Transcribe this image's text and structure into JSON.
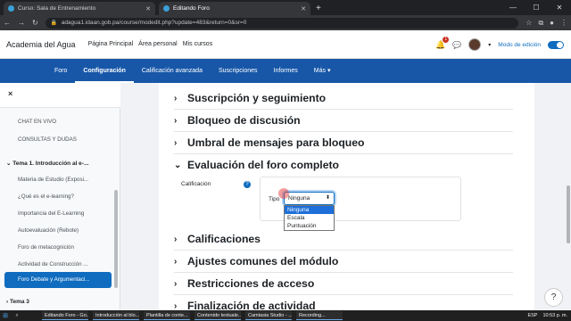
{
  "browser": {
    "tabs": [
      {
        "label": "Curso: Sala de Entrenamiento",
        "active": false
      },
      {
        "label": "Editando Foro",
        "active": true
      }
    ],
    "url": "adagua1.idaan.gob.pa/course/modedit.php?update=483&return=0&sr=0"
  },
  "header": {
    "site_name": "Academia del Agua",
    "links": [
      "Página Principal",
      "Área personal",
      "Mis cursos"
    ],
    "notification_count": "1",
    "edit_mode_label": "Modo de edición"
  },
  "secondary_nav": {
    "items": [
      "Foro",
      "Configuración",
      "Calificación avanzada",
      "Suscripciones",
      "Informes",
      "Más"
    ],
    "active": "Configuración"
  },
  "drawer": {
    "close_label": "×",
    "items": [
      {
        "label": "CHAT EN VIVO",
        "kind": "item"
      },
      {
        "label": "CONSULTAS Y DUDAS",
        "kind": "item"
      },
      {
        "label": "Tema 1. Introducción al e-...",
        "kind": "section"
      },
      {
        "label": "Materia de Estudio (Exposi...",
        "kind": "item"
      },
      {
        "label": "¿Qué es el e-learning?",
        "kind": "item"
      },
      {
        "label": "Importancia del E-Learning",
        "kind": "item"
      },
      {
        "label": "Autoevaluación (Rebote)",
        "kind": "item"
      },
      {
        "label": "Foro de metacognición",
        "kind": "item"
      },
      {
        "label": "Actividad de Construcción ...",
        "kind": "item"
      }
    ],
    "active_item": "Foro Debate y Argumentaci...",
    "next_section": "Tema 3"
  },
  "form": {
    "sections": [
      {
        "label": "Suscripción y seguimiento",
        "expanded": false
      },
      {
        "label": "Bloqueo de discusión",
        "expanded": false
      },
      {
        "label": "Umbral de mensajes para bloqueo",
        "expanded": false
      },
      {
        "label": "Evaluación del foro completo",
        "expanded": true
      },
      {
        "label": "Calificaciones",
        "expanded": false
      },
      {
        "label": "Ajustes comunes del módulo",
        "expanded": false
      },
      {
        "label": "Restricciones de acceso",
        "expanded": false
      },
      {
        "label": "Finalización de actividad",
        "expanded": false
      }
    ],
    "grade_label": "Calificación",
    "type_label": "Tipo",
    "select_value": "Ninguna",
    "options": [
      "Ninguna",
      "Escala",
      "Puntuación"
    ]
  },
  "taskbar": {
    "apps": [
      "Editando Foro - Go...",
      "Introducción al blo...",
      "Plantilla de conte...",
      "Contenido textuale...",
      "Camtasia Studio - ...",
      "Recording..."
    ],
    "lang": "ESP",
    "time": "10:53 p. m."
  }
}
